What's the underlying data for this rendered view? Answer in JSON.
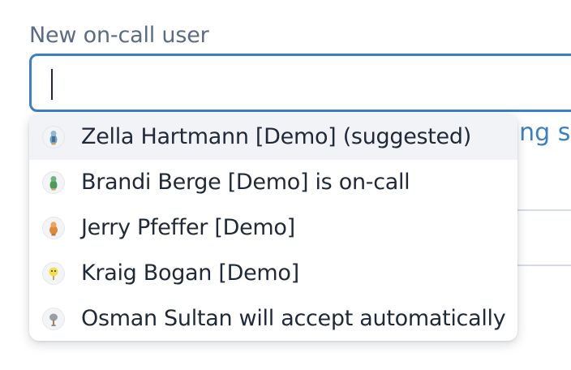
{
  "field": {
    "label": "New on-call user",
    "value": ""
  },
  "background": {
    "partial_text": "ting s"
  },
  "options": [
    {
      "label": "Zella Hartmann [Demo] (suggested)",
      "avatar_icon": "person-avatar-icon",
      "highlighted": true
    },
    {
      "label": "Brandi Berge [Demo] is on-call",
      "avatar_icon": "person-avatar-icon",
      "highlighted": false
    },
    {
      "label": "Jerry Pfeffer [Demo]",
      "avatar_icon": "person-avatar-icon",
      "highlighted": false
    },
    {
      "label": "Kraig Bogan [Demo]",
      "avatar_icon": "person-avatar-icon",
      "highlighted": false
    },
    {
      "label": "Osman Sultan will accept automatically",
      "avatar_icon": "person-avatar-icon",
      "highlighted": false
    }
  ],
  "colors": {
    "focus_border": "#3b7fc4",
    "label": "#5a6b86",
    "text": "#1f2937",
    "highlight_row": "#f1f3f6"
  }
}
